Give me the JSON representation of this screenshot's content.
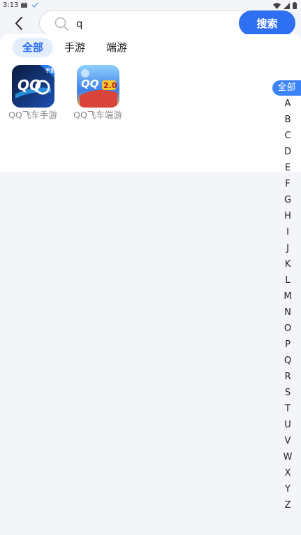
{
  "status_bar": {
    "time": "3:13"
  },
  "search": {
    "value": "q",
    "button_label": "搜索"
  },
  "tabs": [
    {
      "label": "全部",
      "active": true
    },
    {
      "label": "手游",
      "active": false
    },
    {
      "label": "端游",
      "active": false
    }
  ],
  "games": [
    {
      "name": "QQ飞车手游",
      "badge": "手游"
    },
    {
      "name": "QQ飞车端游",
      "badge": ""
    }
  ],
  "index": {
    "all_label": "全部",
    "letters": [
      "A",
      "B",
      "C",
      "D",
      "E",
      "F",
      "G",
      "H",
      "I",
      "J",
      "K",
      "L",
      "M",
      "N",
      "O",
      "P",
      "Q",
      "R",
      "S",
      "T",
      "U",
      "V",
      "W",
      "X",
      "Y",
      "Z"
    ]
  },
  "colors": {
    "accent": "#2f6ff2",
    "tab_active_bg": "#e2eefc",
    "index_active_bg": "#3b82f6"
  }
}
